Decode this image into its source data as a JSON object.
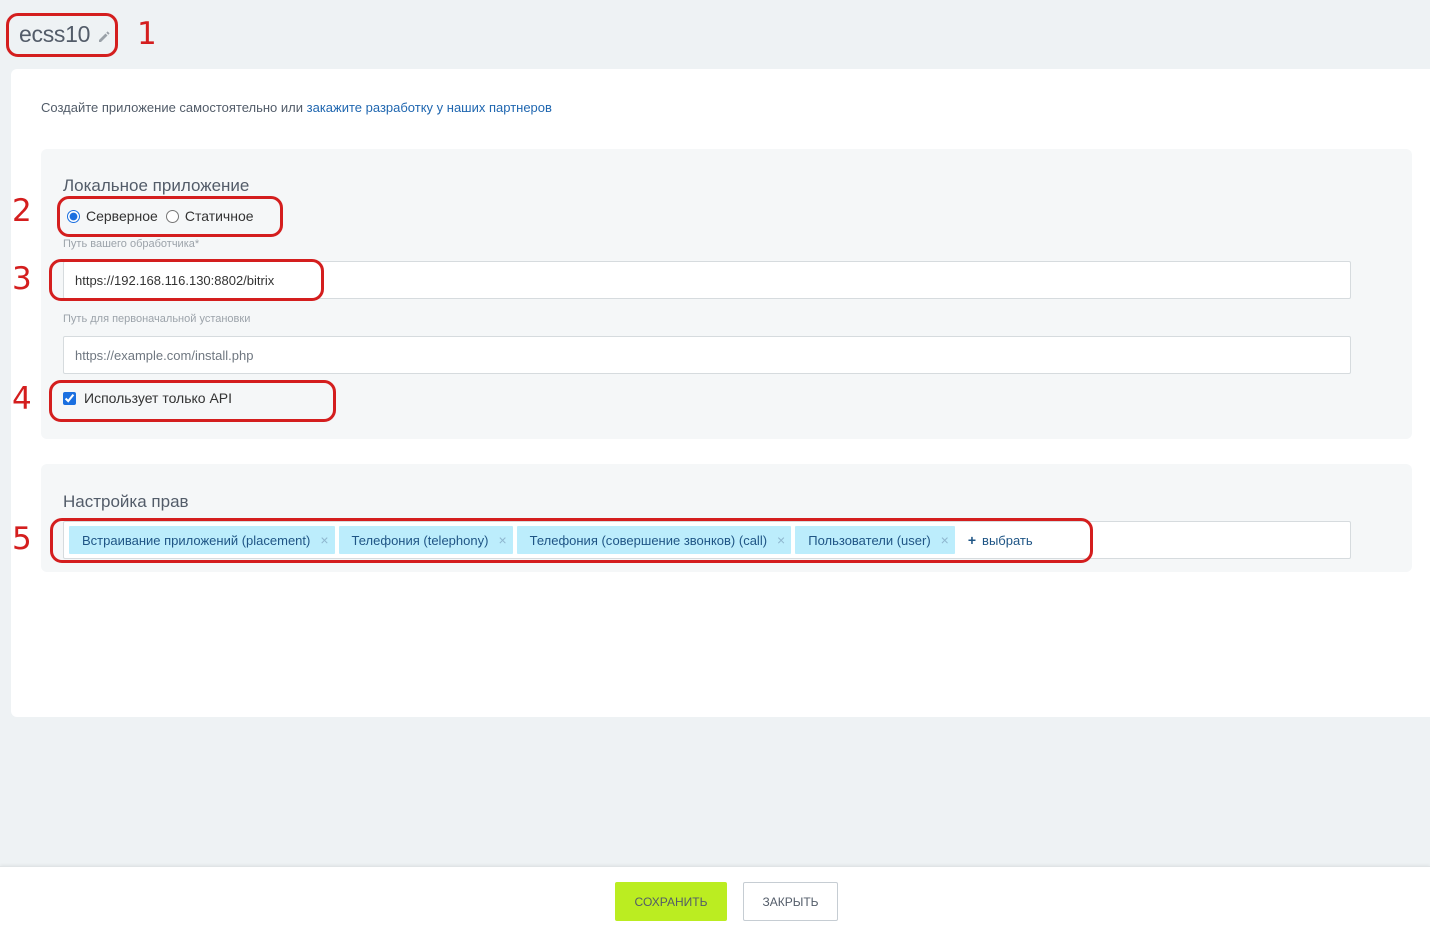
{
  "header": {
    "title": "ecss10"
  },
  "intro": {
    "text": "Создайте приложение самостоятельно или ",
    "link": "закажите разработку у наших партнеров"
  },
  "local_app": {
    "section_title": "Локальное приложение",
    "type_options": [
      {
        "label": "Серверное",
        "selected": true
      },
      {
        "label": "Статичное",
        "selected": false
      }
    ],
    "handler_label": "Путь вашего обработчика*",
    "handler_value": "https://192.168.116.130:8802/bitrix",
    "install_label": "Путь для первоначальной установки",
    "install_placeholder": "https://example.com/install.php",
    "api_only_label": "Использует только API",
    "api_only_checked": true
  },
  "rights": {
    "section_title": "Настройка прав",
    "tags": [
      {
        "label": "Встраивание приложений (placement)"
      },
      {
        "label": "Телефония (telephony)"
      },
      {
        "label": "Телефония (совершение звонков) (call)"
      },
      {
        "label": "Пользователи (user)"
      }
    ],
    "add_label": "выбрать",
    "remove_glyph": "×",
    "add_glyph": "+"
  },
  "annotations": {
    "labels": [
      "1",
      "2",
      "3",
      "4",
      "5"
    ],
    "color": "#d41e1e"
  },
  "footer": {
    "save_label": "СОХРАНИТЬ",
    "close_label": "ЗАКРЫТЬ"
  },
  "colors": {
    "page_bg": "#eef2f4",
    "save_button": "#bbed21",
    "tag_bg": "#bcedfc",
    "link": "#2067b0"
  },
  "icons": {
    "edit": "pencil-icon"
  }
}
